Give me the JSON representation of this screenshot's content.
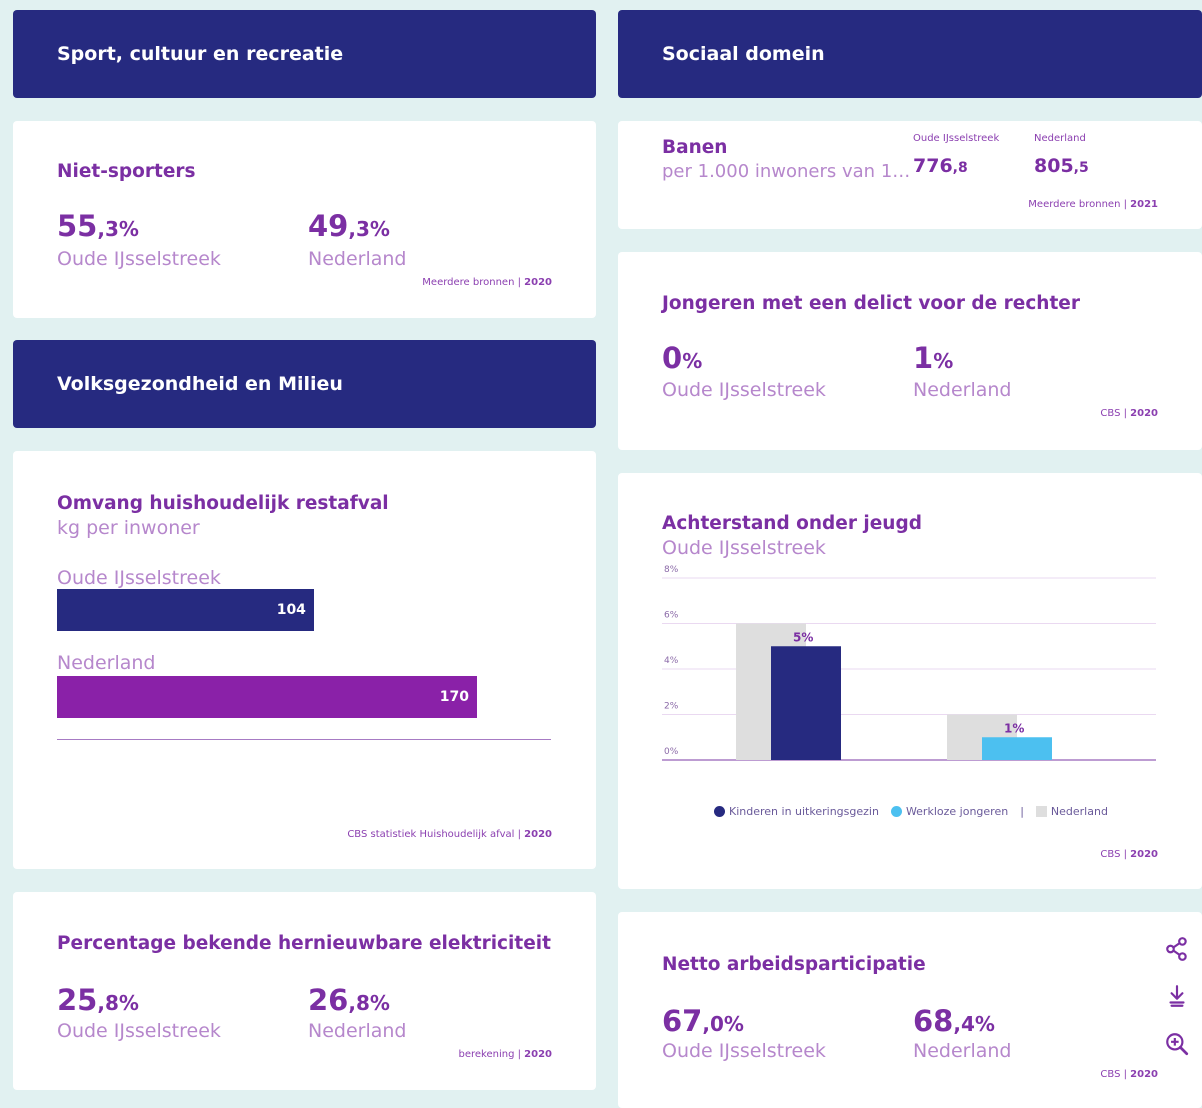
{
  "left": {
    "header1": "Sport, cultuur en recreatie",
    "niet_sporters": {
      "title": "Niet-sporters",
      "a_int": "55",
      "a_dec": ",3%",
      "a_label": "Oude IJsselstreek",
      "b_int": "49",
      "b_dec": ",3%",
      "b_label": "Nederland",
      "source": "Meerdere bronnen",
      "year": "2020"
    },
    "header2": "Volksgezondheid en Milieu",
    "restafval": {
      "title": "Omvang huishoudelijk restafval",
      "subtitle": "kg per inwoner",
      "bar1_label": "Oude IJsselstreek",
      "bar1_value": 104,
      "bar2_label": "Nederland",
      "bar2_value": 170,
      "max": 200,
      "colors": {
        "bar1": "#262a80",
        "bar2": "#8a21a8"
      },
      "source": "CBS statistiek Huishoudelijk afval",
      "year": "2020"
    },
    "hernieuwbaar": {
      "title": "Percentage bekende hernieuwbare elektriciteit",
      "a_int": "25",
      "a_dec": ",8%",
      "a_label": "Oude IJsselstreek",
      "b_int": "26",
      "b_dec": ",8%",
      "b_label": "Nederland",
      "source": "berekening",
      "year": "2020"
    }
  },
  "right": {
    "header": "Sociaal domein",
    "banen": {
      "title": "Banen",
      "subtitle": "per 1.000 inwoners van 1…",
      "col1_label": "Oude IJsselstreek",
      "col1_int": "776",
      "col1_dec": ",8",
      "col2_label": "Nederland",
      "col2_int": "805",
      "col2_dec": ",5",
      "source": "Meerdere bronnen",
      "year": "2021"
    },
    "jongeren": {
      "title": "Jongeren met een delict voor de rechter",
      "a_int": "0",
      "a_dec": "%",
      "a_label": "Oude IJsselstreek",
      "b_int": "1",
      "b_dec": "%",
      "b_label": "Nederland",
      "source": "CBS",
      "year": "2020"
    },
    "achterstand": {
      "title": "Achterstand onder jeugd",
      "subtitle": "Oude IJsselstreek",
      "legend1": "Kinderen in uitkeringsgezin",
      "legend2": "Werkloze jongeren",
      "legend_sep": "|",
      "legend3": "Nederland",
      "source": "CBS",
      "year": "2020"
    },
    "netto": {
      "title": "Netto arbeidsparticipatie",
      "a_int": "67",
      "a_dec": ",0%",
      "a_label": "Oude IJsselstreek",
      "b_int": "68",
      "b_dec": ",4%",
      "b_label": "Nederland",
      "source": "CBS",
      "year": "2020",
      "icons": [
        "share-icon",
        "download-icon",
        "zoom-icon"
      ]
    }
  },
  "chart_data": {
    "type": "bar",
    "categories": [
      "Kinderen in uitkeringsgezin",
      "Werkloze jongeren"
    ],
    "series": [
      {
        "name": "Nederland",
        "values": [
          6,
          2
        ],
        "color": "#dedede"
      },
      {
        "name": "Oude IJsselstreek",
        "values": [
          5,
          1
        ],
        "colors": [
          "#262a80",
          "#4cc0f0"
        ]
      }
    ],
    "data_labels": [
      "5%",
      "1%"
    ],
    "yticks": [
      "0%",
      "2%",
      "4%",
      "6%",
      "8%"
    ],
    "ylim": [
      0,
      8
    ],
    "grid": true,
    "legend_position": "bottom"
  }
}
